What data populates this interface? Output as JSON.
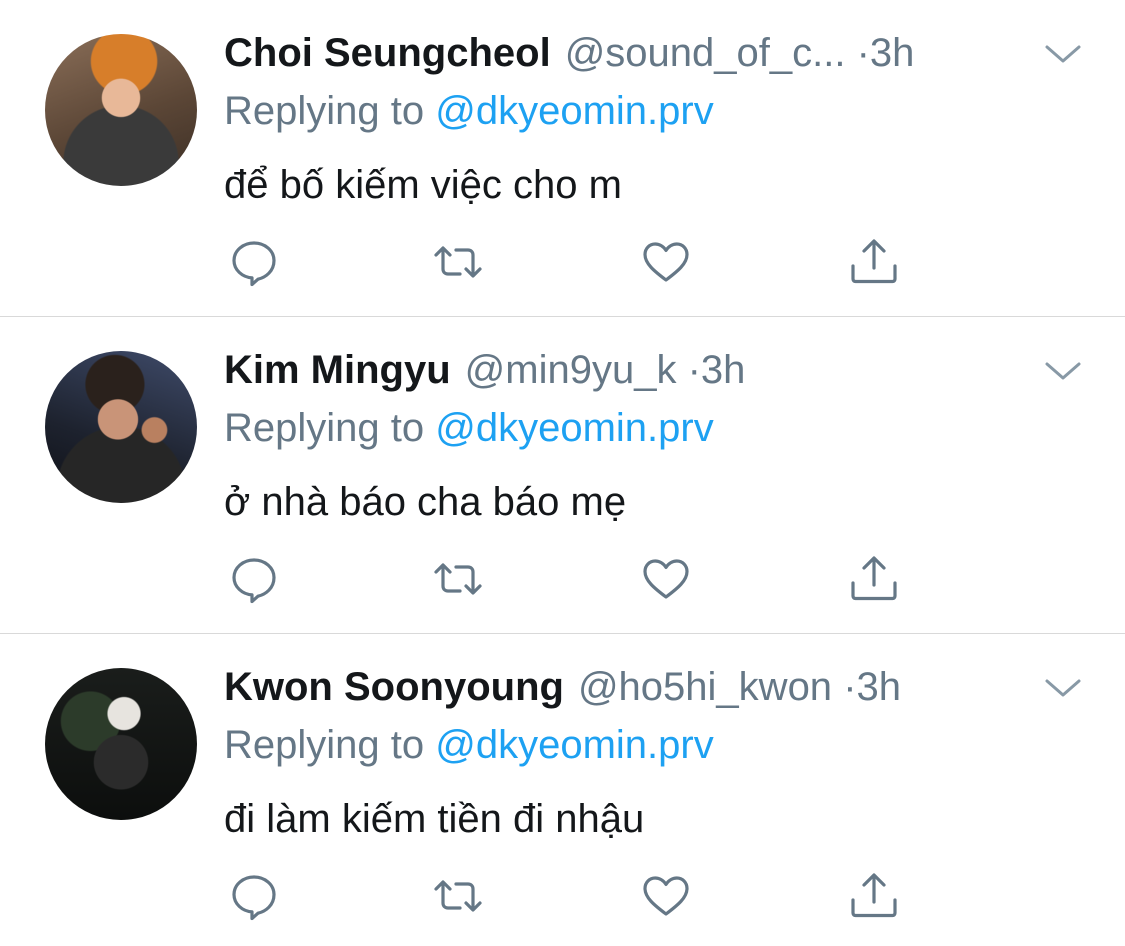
{
  "tweets": [
    {
      "name": "Choi Seungcheol",
      "handle": "@sound_of_c...",
      "separator": "·",
      "time": "3h",
      "reply_prefix": "Replying to ",
      "reply_to": "@dkyeomin.prv",
      "text": "để bố kiếm việc cho m"
    },
    {
      "name": "Kim Mingyu",
      "handle": "@min9yu_k",
      "separator": "·",
      "time": "3h",
      "reply_prefix": "Replying to ",
      "reply_to": "@dkyeomin.prv",
      "text": "ở nhà báo cha báo mẹ"
    },
    {
      "name": "Kwon Soonyoung",
      "handle": "@ho5hi_kwon",
      "separator": "·",
      "time": "3h",
      "reply_prefix": "Replying to ",
      "reply_to": "@dkyeomin.prv",
      "text": "đi làm kiếm tiền đi nhậu"
    }
  ],
  "icons": {
    "reply": "reply-icon",
    "retweet": "retweet-icon",
    "like": "heart-icon",
    "share": "share-icon",
    "more": "chevron-down-icon"
  },
  "colors": {
    "accent": "#1da1f2",
    "muted": "#657786",
    "text": "#14171a",
    "divider": "#d9d9d9"
  }
}
